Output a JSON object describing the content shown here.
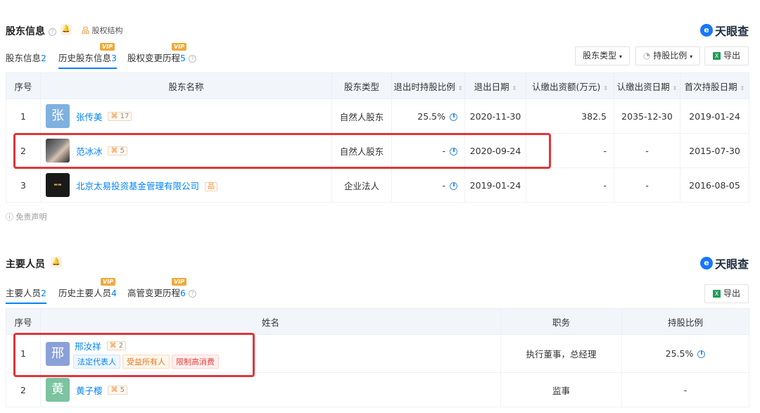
{
  "shareholders": {
    "title": "股东信息",
    "equity_link": "股权结构",
    "brand": "天眼查",
    "tabs": [
      {
        "label": "股东信息",
        "count": "2",
        "vip": ""
      },
      {
        "label": "历史股东信息",
        "count": "3",
        "vip": "VIP"
      },
      {
        "label": "股权变更历程",
        "count": "5",
        "vip": "VIP"
      }
    ],
    "filters": {
      "type": "股东类型",
      "ratio": "持股比例",
      "export": "导出"
    },
    "columns": [
      "序号",
      "股东名称",
      "股东类型",
      "退出时持股比例",
      "退出日期",
      "认缴出资额(万元)",
      "认缴出资日期",
      "首次持股日期"
    ],
    "rows": [
      {
        "index": "1",
        "avatar_char": "张",
        "name": "张传美",
        "tag_count": "17",
        "type": "自然人股东",
        "exit_ratio": "25.5%",
        "exit_date": "2020-11-30",
        "amount": "382.5",
        "sub_date": "2035-12-30",
        "first_date": "2019-01-24"
      },
      {
        "index": "2",
        "avatar_char": "",
        "name": "范冰冰",
        "tag_count": "5",
        "type": "自然人股东",
        "exit_ratio": "-",
        "exit_date": "2020-09-24",
        "amount": "-",
        "sub_date": "-",
        "first_date": "2015-07-30"
      },
      {
        "index": "3",
        "avatar_char": "",
        "name": "北京太易投资基金管理有限公司",
        "tag_count": "",
        "type": "企业法人",
        "exit_ratio": "-",
        "exit_date": "2019-01-24",
        "amount": "-",
        "sub_date": "-",
        "first_date": "2016-08-05"
      }
    ],
    "disclaimer": "免责声明"
  },
  "personnel": {
    "title": "主要人员",
    "brand": "天眼查",
    "tabs": [
      {
        "label": "主要人员",
        "count": "2",
        "vip": ""
      },
      {
        "label": "历史主要人员",
        "count": "4",
        "vip": "VIP"
      },
      {
        "label": "高管变更历程",
        "count": "6",
        "vip": "VIP"
      }
    ],
    "export": "导出",
    "columns": [
      "序号",
      "姓名",
      "职务",
      "持股比例"
    ],
    "rows": [
      {
        "index": "1",
        "avatar_char": "邢",
        "name": "邢汝祥",
        "tag_count": "2",
        "chips": [
          "法定代表人",
          "受益所有人",
          "限制高消费"
        ],
        "position": "执行董事，总经理",
        "ratio": "25.5%"
      },
      {
        "index": "2",
        "avatar_char": "黄",
        "name": "黄子樱",
        "tag_count": "5",
        "chips": [],
        "position": "监事",
        "ratio": "-"
      }
    ]
  },
  "colors": {
    "accent": "#0084ff",
    "highlight": "#e0363b",
    "vip": "#f0a93b",
    "header_bg": "#f2f6fb"
  }
}
